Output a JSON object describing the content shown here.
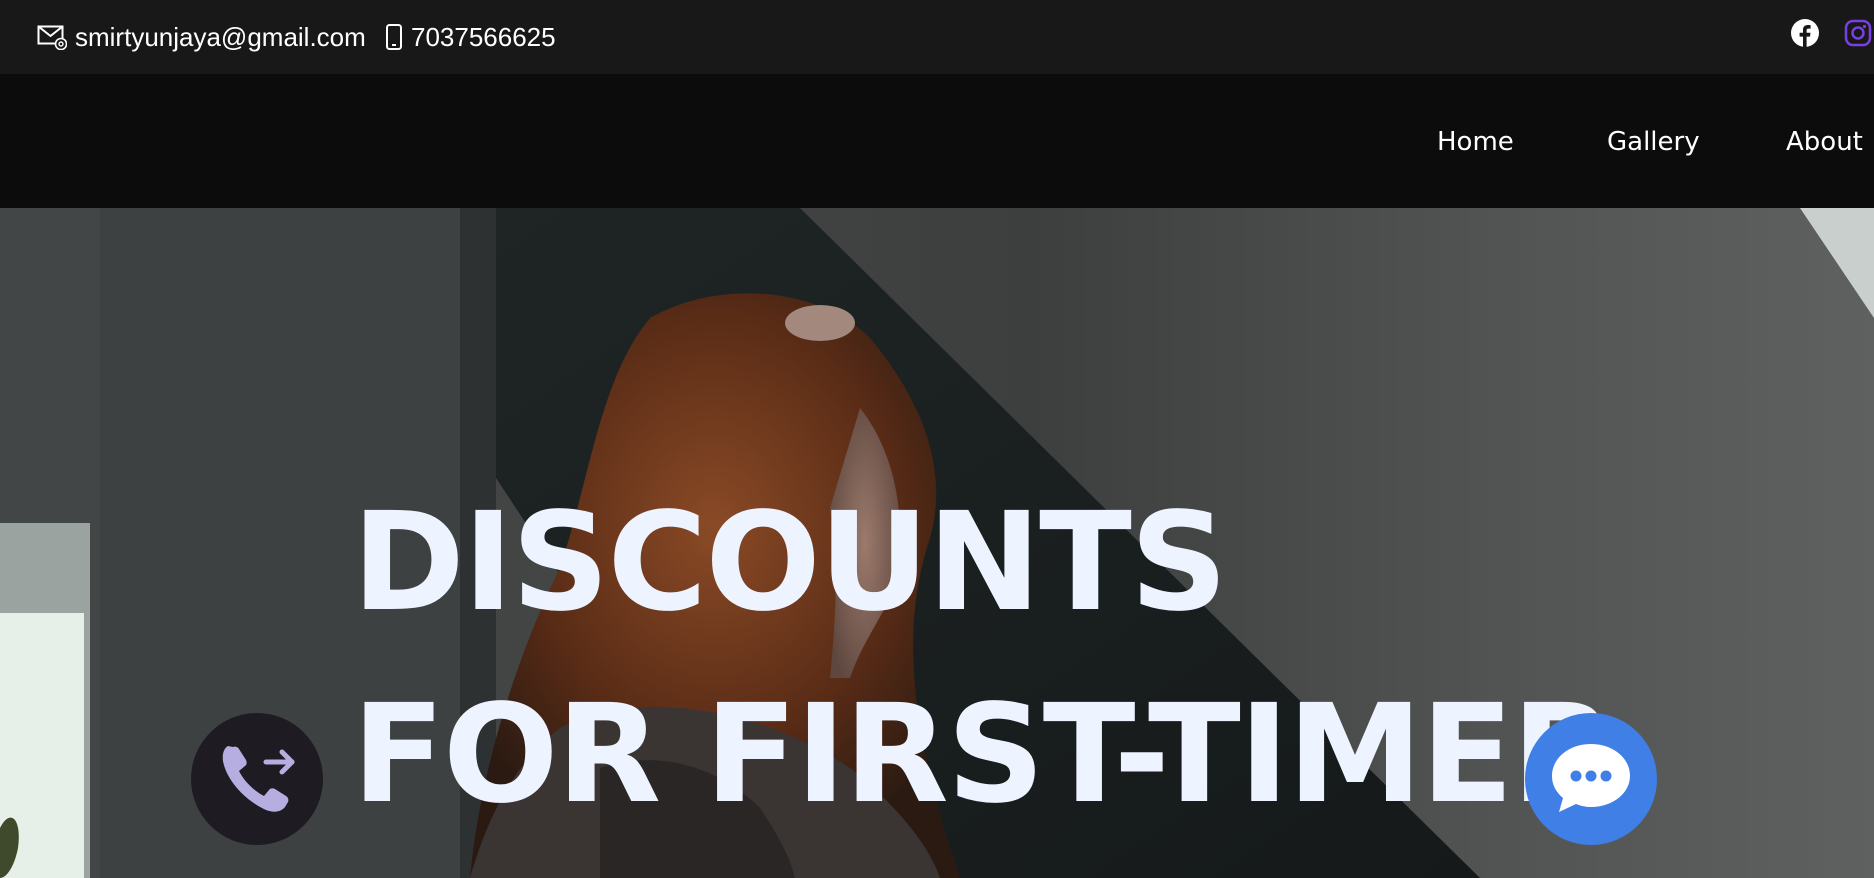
{
  "topbar": {
    "email": "smirtyunjaya@gmail.com",
    "phone": "7037566625",
    "email_icon": "envelope-icon",
    "phone_icon": "mobile-phone-icon",
    "social": [
      {
        "name": "facebook",
        "icon": "facebook-icon"
      },
      {
        "name": "instagram",
        "icon": "instagram-icon",
        "color": "#7a3fe4"
      }
    ]
  },
  "nav": {
    "items": [
      {
        "label": "Home"
      },
      {
        "label": "Gallery"
      },
      {
        "label": "About"
      }
    ]
  },
  "hero": {
    "title_line1": "DISCOUNTS",
    "title_line2": "FOR FIRST-TIMER",
    "text_color": "#eef4ff"
  },
  "floating": {
    "call_button": {
      "icon": "phone-forward-icon",
      "background": "#1e1b22",
      "icon_color": "#b6aee0"
    },
    "chat_button": {
      "icon": "chat-bubble-icon",
      "background": "#3f7fe6"
    }
  }
}
